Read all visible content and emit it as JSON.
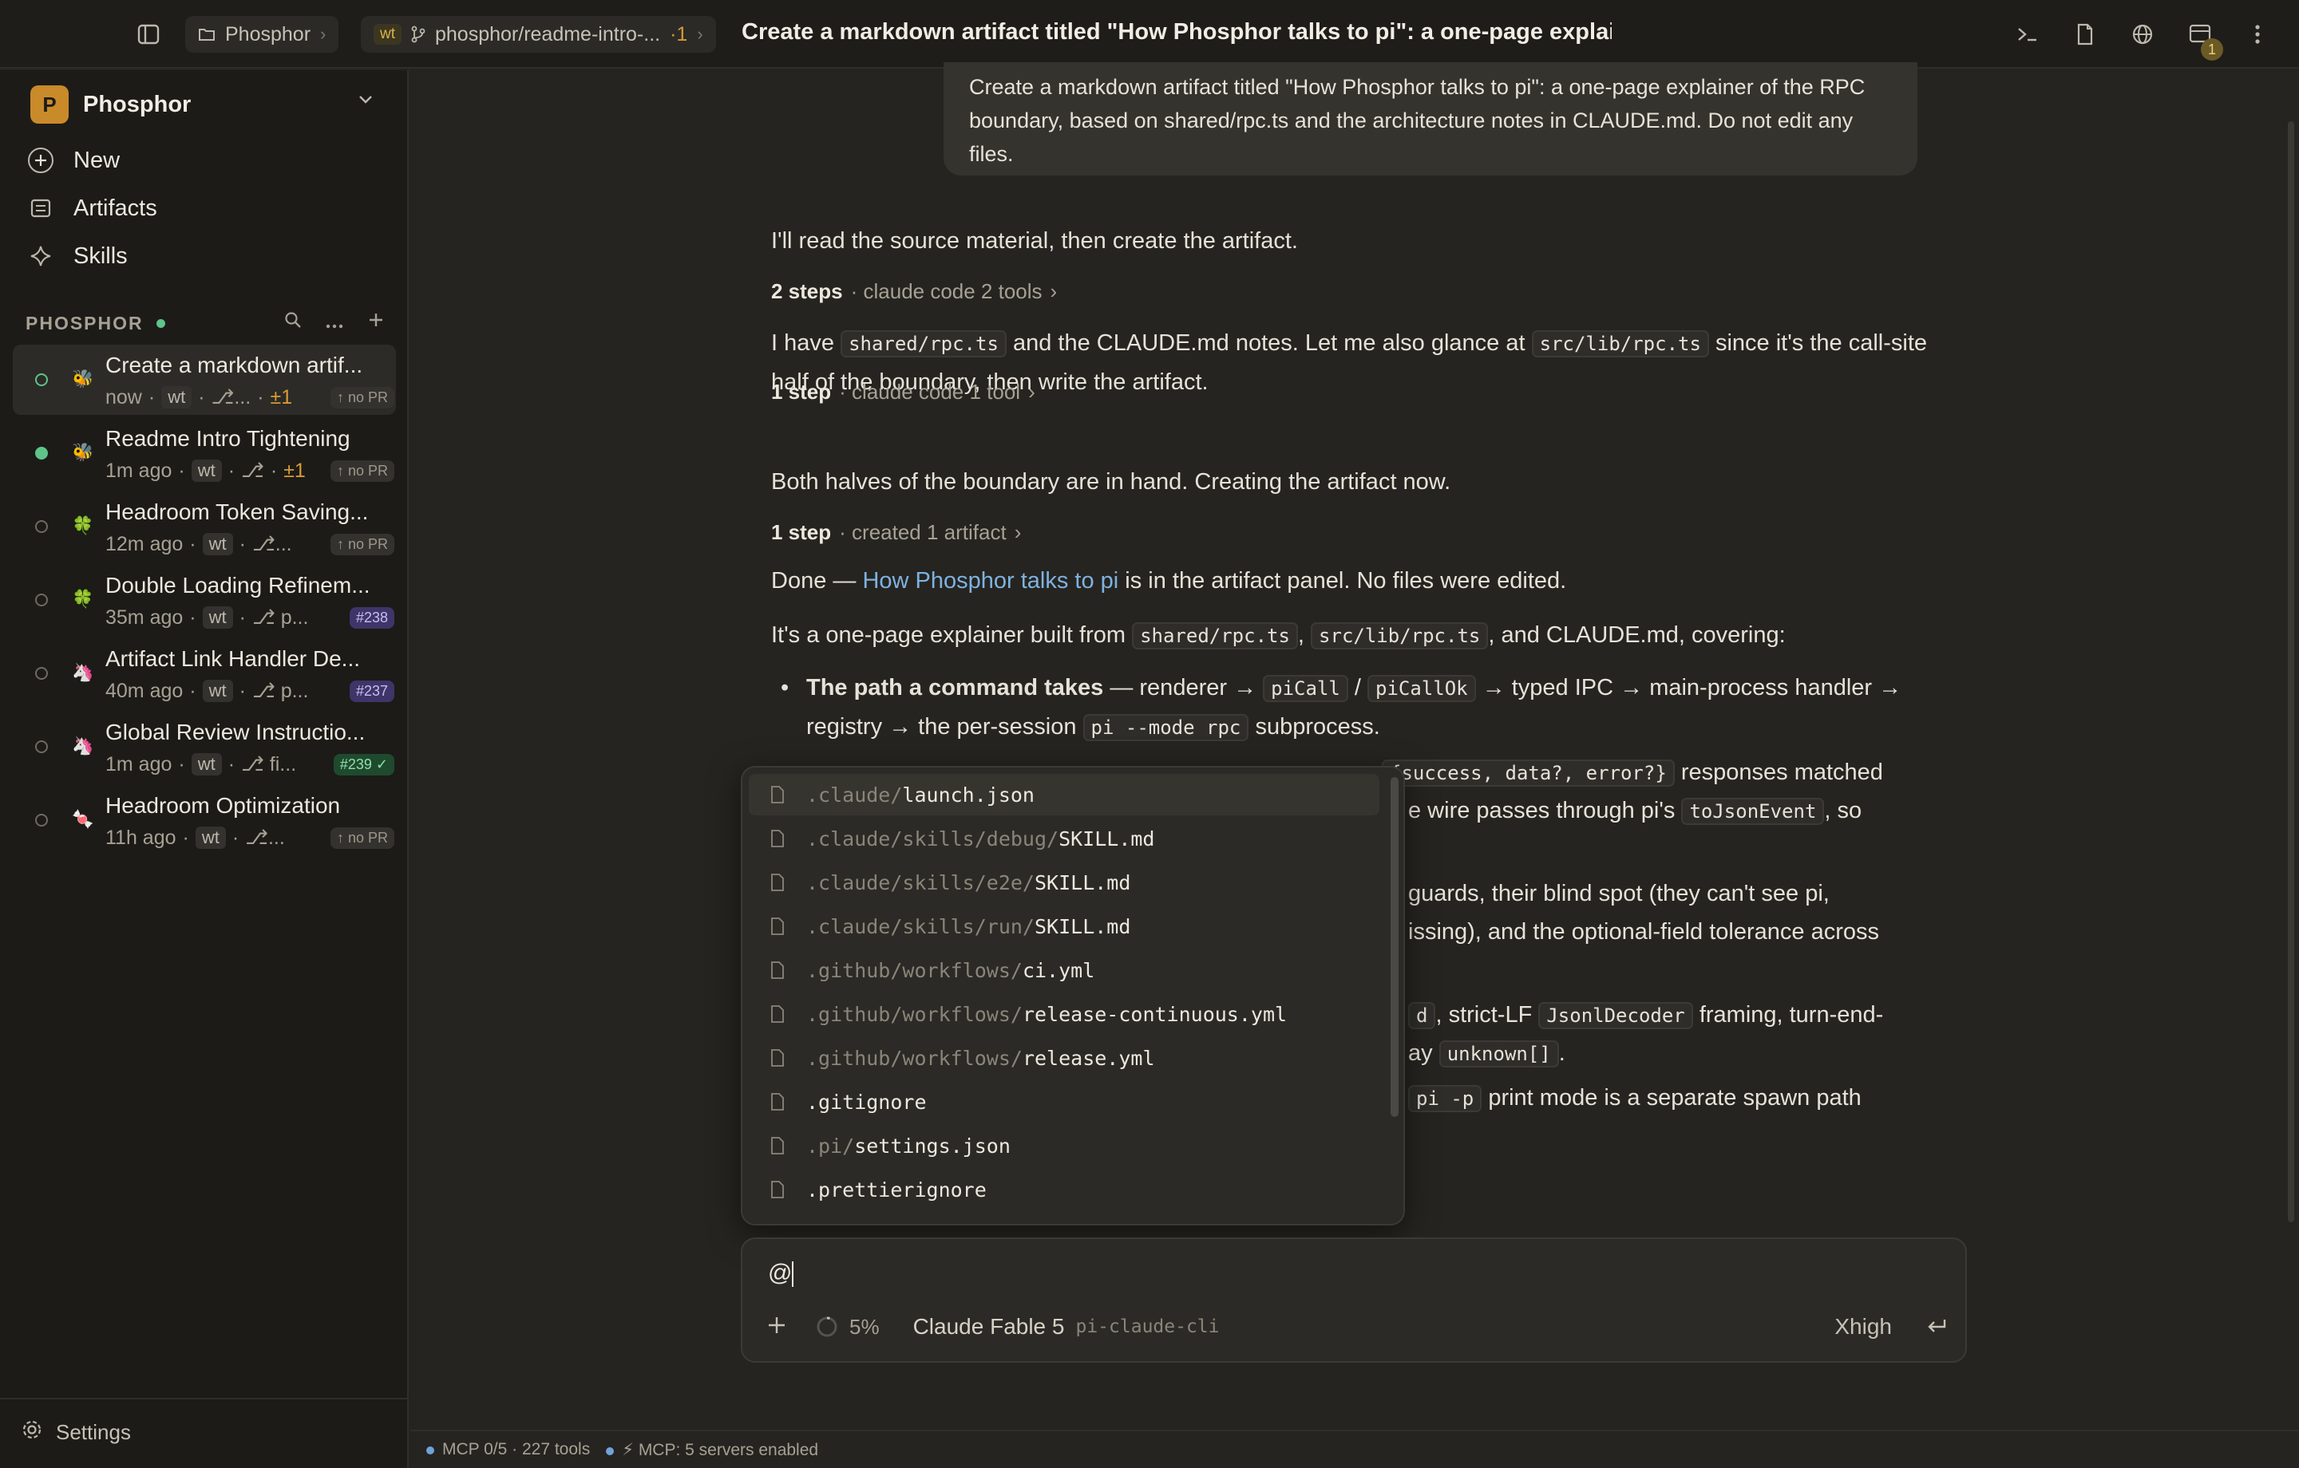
{
  "topbar": {
    "workspace_crumb": "Phosphor",
    "wt_badge": "wt",
    "branch_crumb": "phosphor/readme-intro-...",
    "branch_changes": "·1",
    "title": "Create a markdown artifact titled \"How Phosphor talks to pi\": a one-page explai...",
    "notification_count": "1"
  },
  "sidebar": {
    "workspace_initial": "P",
    "workspace_name": "Phosphor",
    "nav": [
      {
        "label": "New",
        "icon": "plus-circle-icon"
      },
      {
        "label": "Artifacts",
        "icon": "artifacts-icon"
      },
      {
        "label": "Skills",
        "icon": "sparkle-icon"
      }
    ],
    "section_title": "PHOSPHOR",
    "sessions": [
      {
        "title": "Create a markdown artif...",
        "time": "now",
        "wt": "wt",
        "branch": "⎇...",
        "changes": "±1",
        "pr": "↑ no PR"
      },
      {
        "title": "Readme Intro Tightening",
        "time": "1m ago",
        "wt": "wt",
        "branch": "⎇",
        "changes": "±1",
        "pr": "↑ no PR"
      },
      {
        "title": "Headroom Token Saving...",
        "time": "12m ago",
        "wt": "wt",
        "branch": "⎇...",
        "changes": "",
        "pr": "↑ no PR"
      },
      {
        "title": "Double Loading Refinem...",
        "time": "35m ago",
        "wt": "wt",
        "branch": "⎇ p...",
        "changes": "",
        "pr": "#238"
      },
      {
        "title": "Artifact Link Handler De...",
        "time": "40m ago",
        "wt": "wt",
        "branch": "⎇ p...",
        "changes": "",
        "pr": "#237"
      },
      {
        "title": "Global Review Instructio...",
        "time": "1m ago",
        "wt": "wt",
        "branch": "⎇ fi...",
        "changes": "",
        "pr": "#239 ✓"
      },
      {
        "title": "Headroom Optimization",
        "time": "11h ago",
        "wt": "wt",
        "branch": "⎇...",
        "changes": "",
        "pr": "↑ no PR"
      }
    ],
    "settings_label": "Settings"
  },
  "chat": {
    "user_message": "Create a markdown artifact titled \"How Phosphor talks to pi\": a one-page explainer of the RPC boundary, based on shared/rpc.ts and the architecture notes in CLAUDE.md. Do not edit any files.",
    "m1": "I'll read the source material, then create the artifact.",
    "s1_count": "2 steps",
    "s1_detail": "· claude code 2 tools",
    "m2_a": "I have",
    "m2_code1": "shared/rpc.ts",
    "m2_b": "and the CLAUDE.md notes. Let me also glance at",
    "m2_code2": "src/lib/rpc.ts",
    "m2_c": "since it's the call-site half of the boundary, then write the artifact.",
    "s2_count": "1 step",
    "s2_detail": "· claude code 1 tool",
    "m3": "Both halves of the boundary are in hand. Creating the artifact now.",
    "s3_count": "1 step",
    "s3_detail": "· created 1 artifact",
    "m4_a": "Done —",
    "m4_link": "How Phosphor talks to pi",
    "m4_b": "is in the artifact panel. No files were edited.",
    "m5_a": "It's a one-page explainer built from",
    "m5_code1": "shared/rpc.ts",
    "m5_sep": ",",
    "m5_code2": "src/lib/rpc.ts",
    "m5_b": ", and CLAUDE.md, covering:",
    "b1_bold": "The path a command takes",
    "b1_a": "— renderer →",
    "b1_code1": "piCall",
    "b1_slash": "/",
    "b1_code2": "piCallOk",
    "b1_b": "→ typed IPC → main-process handler → registry → the per-session",
    "b1_code3": "pi --mode rpc",
    "b1_c": "subprocess.",
    "b2_tail_code": "{success, data?, error?}",
    "b2_tail_a": "responses matched",
    "b2_tail_b": "e wire passes through pi's",
    "b2_tail_code2": "toJsonEvent",
    "b2_tail_c": ", so",
    "b3_tail_a": "guards, their blind spot (they can't see pi,",
    "b3_tail_b": "issing), and the optional-field tolerance across",
    "b4_tail_code": "d",
    "b4_tail_a": ", strict-LF",
    "b4_tail_code2": "JsonlDecoder",
    "b4_tail_b": "framing, turn-end-",
    "b4_tail_c": "ay",
    "b4_tail_code3": "unknown[]",
    "b4_tail_d": ".",
    "b5_tail_code": "pi -p",
    "b5_tail_a": "print mode is a separate spawn path"
  },
  "file_picker": {
    "items": [
      {
        "dir": ".claude/",
        "name": "launch.json"
      },
      {
        "dir": ".claude/skills/debug/",
        "name": "SKILL.md"
      },
      {
        "dir": ".claude/skills/e2e/",
        "name": "SKILL.md"
      },
      {
        "dir": ".claude/skills/run/",
        "name": "SKILL.md"
      },
      {
        "dir": ".github/workflows/",
        "name": "ci.yml"
      },
      {
        "dir": ".github/workflows/",
        "name": "release-continuous.yml"
      },
      {
        "dir": ".github/workflows/",
        "name": "release.yml"
      },
      {
        "dir": "",
        "name": ".gitignore"
      },
      {
        "dir": ".pi/",
        "name": "settings.json"
      },
      {
        "dir": "",
        "name": ".prettierignore"
      }
    ]
  },
  "composer": {
    "input_value": "@",
    "context_usage": "5%",
    "model_name": "Claude Fable 5",
    "model_provider": "pi-claude-cli",
    "thinking_level": "Xhigh"
  },
  "statusbar": {
    "mcp_tools": "MCP 0/5 · 227 tools",
    "mcp_servers": "MCP: 5 servers enabled"
  },
  "colors": {
    "background": "#252420",
    "sidebar": "#1c1b18",
    "accent_link": "#7fb2e0",
    "status_green": "#5ec48a",
    "workspace_logo": "#c98a2a"
  }
}
